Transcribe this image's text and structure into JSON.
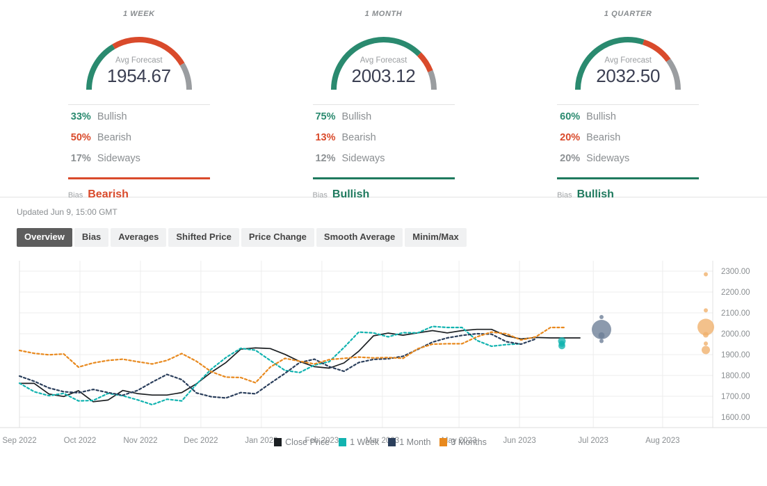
{
  "panels": [
    {
      "title": "1 WEEK",
      "gauge_label": "Avg Forecast",
      "value": "1954.67",
      "bullish_pct": "33%",
      "bullish_label": "Bullish",
      "bearish_pct": "50%",
      "bearish_label": "Bearish",
      "sideways_pct": "17%",
      "sideways_label": "Sideways",
      "bias_key": "Bias",
      "bias_value": "Bearish",
      "bias_color": "#d94a2b",
      "arc": {
        "green": 33,
        "red": 50,
        "gray": 17
      }
    },
    {
      "title": "1 MONTH",
      "gauge_label": "Avg Forecast",
      "value": "2003.12",
      "bullish_pct": "75%",
      "bullish_label": "Bullish",
      "bearish_pct": "13%",
      "bearish_label": "Bearish",
      "sideways_pct": "12%",
      "sideways_label": "Sideways",
      "bias_key": "Bias",
      "bias_value": "Bullish",
      "bias_color": "#1f7a5e",
      "arc": {
        "green": 75,
        "red": 13,
        "gray": 12
      }
    },
    {
      "title": "1 QUARTER",
      "gauge_label": "Avg Forecast",
      "value": "2032.50",
      "bullish_pct": "60%",
      "bullish_label": "Bullish",
      "bearish_pct": "20%",
      "bearish_label": "Bearish",
      "sideways_pct": "20%",
      "sideways_label": "Sideways",
      "bias_key": "Bias",
      "bias_value": "Bullish",
      "bias_color": "#1f7a5e",
      "arc": {
        "green": 60,
        "red": 20,
        "gray": 20
      }
    }
  ],
  "updated": "Updated Jun 9, 15:00 GMT",
  "tabs": [
    {
      "label": "Overview",
      "active": true
    },
    {
      "label": "Bias",
      "active": false
    },
    {
      "label": "Averages",
      "active": false
    },
    {
      "label": "Shifted Price",
      "active": false
    },
    {
      "label": "Price Change",
      "active": false
    },
    {
      "label": "Smooth Average",
      "active": false
    },
    {
      "label": "Minim/Max",
      "active": false
    }
  ],
  "colors": {
    "bullish": "#2a8a6f",
    "bearish": "#d94a2b",
    "sideways": "#a8abae",
    "close_price": "#1b1f22",
    "one_week": "#12b3b0",
    "one_month": "#2b3f5c",
    "three_months": "#e8891e",
    "grid": "#ededed",
    "axis_text": "#8a8e91"
  },
  "chart_data": {
    "type": "line",
    "title": "",
    "xlabel": "",
    "ylabel": "",
    "grid": true,
    "legend_position": "bottom",
    "ylim": [
      1550,
      2350
    ],
    "yticks": [
      "1600.00",
      "1700.00",
      "1800.00",
      "1900.00",
      "2000.00",
      "2100.00",
      "2200.00",
      "2300.00"
    ],
    "ytick_values": [
      1600,
      1700,
      1800,
      1900,
      2000,
      2100,
      2200,
      2300
    ],
    "xticks": [
      "Sep 2022",
      "Oct 2022",
      "Nov 2022",
      "Dec 2022",
      "Jan 2023",
      "Feb 2023",
      "Mar 2023",
      "May 2023",
      "Jun 2023",
      "Jul 2023",
      "Aug 2023"
    ],
    "legend": [
      {
        "name": "Close Price",
        "color": "#1b1f22"
      },
      {
        "name": "1 Week",
        "color": "#12b3b0"
      },
      {
        "name": "1 Month",
        "color": "#2b3f5c"
      },
      {
        "name": "3 Months",
        "color": "#e8891e"
      }
    ],
    "series": [
      {
        "name": "Close Price",
        "color": "#1b1f22",
        "style": "solid",
        "x": [
          0,
          1,
          2,
          3,
          4,
          5,
          6,
          7,
          8,
          9,
          10,
          11,
          12,
          13,
          14,
          15,
          16,
          17,
          18,
          19,
          20,
          21,
          22,
          23,
          24,
          25,
          26,
          27,
          28,
          29,
          30,
          31,
          32,
          33,
          34,
          35,
          36,
          37,
          38
        ],
        "values": [
          1762,
          1762,
          1711,
          1699,
          1727,
          1674,
          1682,
          1728,
          1713,
          1706,
          1706,
          1718,
          1760,
          1815,
          1862,
          1926,
          1932,
          1929,
          1901,
          1867,
          1842,
          1835,
          1860,
          1916,
          1990,
          2003,
          1993,
          2004,
          2015,
          2004,
          2015,
          2021,
          2021,
          1990,
          1975,
          1982,
          1980,
          1980,
          1980
        ]
      },
      {
        "name": "1 Week",
        "color": "#12b3b0",
        "style": "dotted",
        "x": [
          0,
          1,
          2,
          3,
          4,
          5,
          6,
          7,
          8,
          9,
          10,
          11,
          12,
          13,
          14,
          15,
          16,
          17,
          18,
          19,
          20,
          21,
          22,
          23,
          24,
          25,
          26,
          27,
          28,
          29,
          30,
          31,
          32,
          33,
          34
        ],
        "values": [
          1763,
          1722,
          1703,
          1714,
          1678,
          1680,
          1714,
          1703,
          1683,
          1660,
          1686,
          1678,
          1758,
          1830,
          1886,
          1930,
          1921,
          1872,
          1824,
          1814,
          1850,
          1866,
          1934,
          2008,
          2004,
          1985,
          2005,
          2004,
          2035,
          2030,
          2030,
          1968,
          1940,
          1948,
          1952
        ]
      },
      {
        "name": "1 Month",
        "color": "#2b3f5c",
        "style": "dotted",
        "x": [
          0,
          1,
          2,
          3,
          4,
          5,
          6,
          7,
          8,
          9,
          10,
          11,
          12,
          13,
          14,
          15,
          16,
          17,
          18,
          19,
          20,
          21,
          22,
          23,
          24,
          25,
          26,
          27,
          28,
          29,
          30,
          31,
          32,
          33,
          34,
          35
        ],
        "values": [
          1797,
          1772,
          1740,
          1722,
          1717,
          1733,
          1718,
          1705,
          1728,
          1768,
          1805,
          1780,
          1716,
          1698,
          1692,
          1718,
          1712,
          1762,
          1810,
          1862,
          1878,
          1842,
          1820,
          1862,
          1877,
          1880,
          1892,
          1925,
          1960,
          1980,
          1992,
          2000,
          1998,
          1962,
          1950,
          1975
        ]
      },
      {
        "name": "3 Months",
        "color": "#e8891e",
        "style": "dotted",
        "x": [
          0,
          1,
          2,
          3,
          4,
          5,
          6,
          7,
          8,
          9,
          10,
          11,
          12,
          13,
          14,
          15,
          16,
          17,
          18,
          19,
          20,
          21,
          22,
          23,
          24,
          25,
          26,
          27,
          28,
          29,
          30,
          31,
          32,
          33,
          34,
          35,
          36,
          37
        ],
        "values": [
          1920,
          1906,
          1899,
          1903,
          1840,
          1860,
          1872,
          1878,
          1866,
          1855,
          1872,
          1905,
          1868,
          1818,
          1792,
          1790,
          1765,
          1840,
          1882,
          1868,
          1855,
          1876,
          1882,
          1888,
          1884,
          1886,
          1882,
          1928,
          1950,
          1952,
          1952,
          1985,
          2008,
          2000,
          1970,
          1985,
          2030,
          2030
        ]
      }
    ],
    "forecast_bubbles": [
      {
        "series": "1 Week",
        "color": "#12b3b0",
        "x_label": "Jun 2023",
        "value": 1965,
        "size": 11
      },
      {
        "series": "1 Week",
        "color": "#12b3b0",
        "x_label": "Jun 2023",
        "value": 1952,
        "size": 9
      },
      {
        "series": "1 Week",
        "color": "#12b3b0",
        "x_label": "Jun 2023",
        "value": 1942,
        "size": 10
      },
      {
        "series": "1 Month",
        "color": "#6b7d96",
        "x_label": "Jul 2023",
        "value": 2080,
        "size": 6
      },
      {
        "series": "1 Month",
        "color": "#6b7d96",
        "x_label": "Jul 2023",
        "value": 2020,
        "size": 28
      },
      {
        "series": "1 Month",
        "color": "#6b7d96",
        "x_label": "Jul 2023",
        "value": 1992,
        "size": 9
      },
      {
        "series": "1 Month",
        "color": "#6b7d96",
        "x_label": "Jul 2023",
        "value": 1965,
        "size": 6
      },
      {
        "series": "3 Months",
        "color": "#f0b06a",
        "x_label": "Aug 2023",
        "value": 2285,
        "size": 6
      },
      {
        "series": "3 Months",
        "color": "#f0b06a",
        "x_label": "Aug 2023",
        "value": 2112,
        "size": 6
      },
      {
        "series": "3 Months",
        "color": "#f0b06a",
        "x_label": "Aug 2023",
        "value": 2032,
        "size": 24
      },
      {
        "series": "3 Months",
        "color": "#f0b06a",
        "x_label": "Aug 2023",
        "value": 1995,
        "size": 8
      },
      {
        "series": "3 Months",
        "color": "#f0b06a",
        "x_label": "Aug 2023",
        "value": 1953,
        "size": 6
      },
      {
        "series": "3 Months",
        "color": "#f0b06a",
        "x_label": "Aug 2023",
        "value": 1922,
        "size": 12
      }
    ]
  }
}
